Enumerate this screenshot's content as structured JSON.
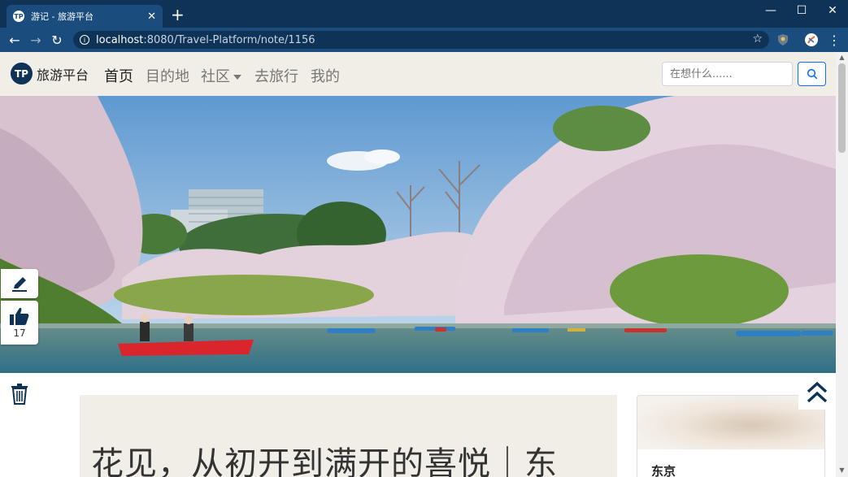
{
  "browser": {
    "tab_title": "游记 - 旅游平台",
    "tab_favicon": "TP",
    "url_host": "localhost",
    "url_path": ":8080/Travel-Platform/note/1156"
  },
  "navbar": {
    "brand_logo": "TP",
    "brand": "旅游平台",
    "items": [
      {
        "label": "首页",
        "active": true
      },
      {
        "label": "目的地",
        "active": false
      },
      {
        "label": "社区",
        "active": false,
        "dropdown": true
      },
      {
        "label": "去旅行",
        "active": false
      },
      {
        "label": "我的",
        "active": false
      }
    ],
    "search_placeholder": "在想什么......"
  },
  "tools": {
    "like_count": "17"
  },
  "article": {
    "title": "花见，从初开到满开的喜悦｜东"
  },
  "sidebar": {
    "card_label": "东京"
  },
  "colors": {
    "chrome_dark": "#0e3356",
    "chrome": "#1a4d7e",
    "navbar_bg": "#f0eee7",
    "accent": "#0d6efd",
    "icon_navy": "#0e3356"
  }
}
